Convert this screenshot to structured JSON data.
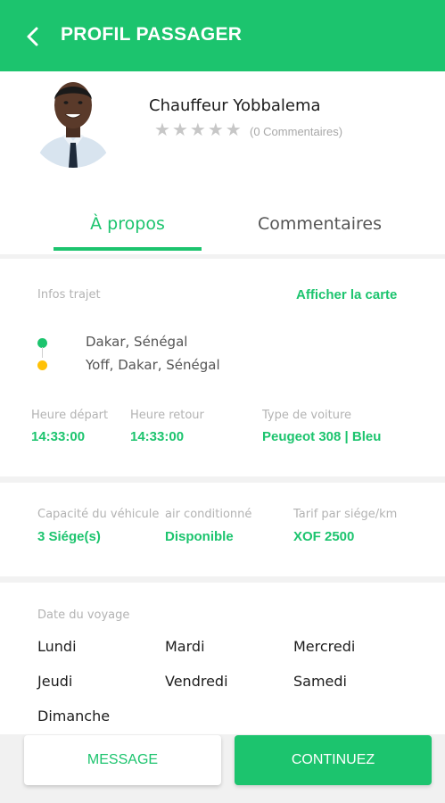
{
  "header": {
    "title": "PROFIL PASSAGER",
    "back_icon": "arrow-left-icon",
    "color": "#1cc46e"
  },
  "profile": {
    "name": "Chauffeur Yobbalema",
    "rating_stars": 0,
    "reviews_label": "(0 Commentaires)"
  },
  "tabs": [
    {
      "label": "À propos",
      "active": true
    },
    {
      "label": "Commentaires",
      "active": false
    }
  ],
  "trip": {
    "section_label": "Infos trajet",
    "map_link": "Afficher la carte",
    "from": "Dakar, Sénégal",
    "to": "Yoff, Dakar, Sénégal",
    "departure_label": "Heure départ",
    "departure_value": "14:33:00",
    "return_label": "Heure retour",
    "return_value": "14:33:00",
    "car_type_label": "Type de voiture",
    "car_type_value": "Peugeot 308 | Bleu"
  },
  "vehicle": {
    "capacity_label": "Capacité du véhicule",
    "capacity_value": "3 Siége(s)",
    "ac_label": "air conditionné",
    "ac_value": "Disponible",
    "price_label": "Tarif par siége/km",
    "price_value": "XOF 2500"
  },
  "schedule": {
    "label": "Date du voyage",
    "days": [
      "Lundi",
      "Mardi",
      "Mercredi",
      "Jeudi",
      "Vendredi",
      "Samedi",
      "Dimanche"
    ]
  },
  "actions": {
    "message": "MESSAGE",
    "continue": "CONTINUEZ"
  },
  "colors": {
    "accent": "#1cc46e",
    "route_end": "#ffc107"
  }
}
